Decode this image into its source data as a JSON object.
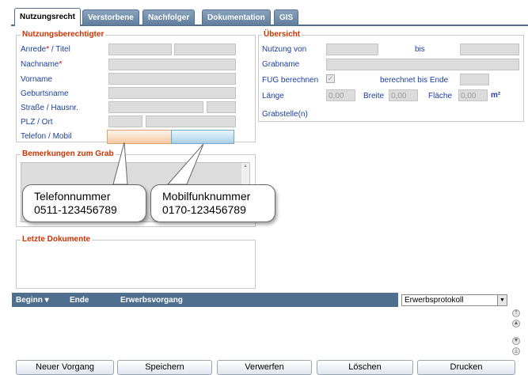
{
  "tabs": [
    {
      "label": "Nutzungsrecht",
      "active": true
    },
    {
      "label": "Verstorbene",
      "active": false
    },
    {
      "label": "Nachfolger",
      "active": false
    },
    {
      "label": "Dokumentation",
      "active": false
    },
    {
      "label": "GIS",
      "active": false
    }
  ],
  "owner_group": {
    "legend": "Nutzungsberechtigter",
    "anrede_label": "Anrede",
    "anrede_suffix": " / Titel",
    "nachname_label": "Nachname",
    "required_mark": "*",
    "vorname_label": "Vorname",
    "geburtsname_label": "Geburtsname",
    "strasse_label": "Straße / Hausnr.",
    "plz_label": "PLZ / Ort",
    "telefon_label": "Telefon / Mobil"
  },
  "overview_group": {
    "legend": "Übersicht",
    "nutzung_von_label": "Nutzung von",
    "bis_label": "bis",
    "grabname_label": "Grabname",
    "fug_label": "FUG berechnen",
    "fug_checked": true,
    "berechnet_label": "berechnet bis Ende",
    "laenge_label": "Länge",
    "laenge_value": "0,00",
    "breite_label": "Breite",
    "breite_value": "0,00",
    "flaeche_label": "Fläche",
    "flaeche_value": "0,00",
    "flaeche_unit": "m²",
    "grabstellen_label": "Grabstelle(n)"
  },
  "remarks_group": {
    "legend": "Bemerkungen zum Grab"
  },
  "docs_group": {
    "legend": "Letzte Dokumente"
  },
  "callouts": {
    "phone": {
      "line1": "Telefonnummer",
      "line2": "0511-123456789"
    },
    "mobile": {
      "line1": "Mobilfunknummer",
      "line2": "0170-123456789"
    }
  },
  "grid": {
    "columns": [
      "Beginn",
      "Ende",
      "Erwerbsvorgang"
    ],
    "sort_indicator": "▾",
    "protocol_select": "Erwerbsprotokoll"
  },
  "buttons": {
    "neuer_vorgang": "Neuer Vorgang",
    "speichern": "Speichern",
    "verwerfen": "Verwerfen",
    "loeschen": "Löschen",
    "drucken": "Drucken"
  },
  "colors": {
    "accent_blue": "#1a3fa0",
    "legend_orange": "#cc3300",
    "required_red": "#e00000",
    "tab_header": "#4f6f8f"
  }
}
